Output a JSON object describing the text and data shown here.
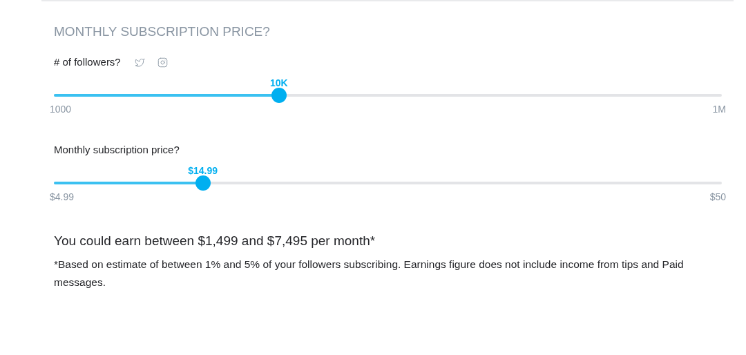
{
  "heading": "MONTHLY SUBSCRIPTION PRICE?",
  "sliders": [
    {
      "label": "# of followers?",
      "social_icons": true,
      "value": "10K",
      "level": 0.337,
      "min": "1000",
      "max": "1M"
    },
    {
      "label": "Monthly subscription price?",
      "social_icons": false,
      "value": "$14.99",
      "level": 0.223,
      "min": "$4.99",
      "max": "$50"
    }
  ],
  "earnings": "You could earn between $1,499 and $7,495 per month*",
  "footnote": "*Based on estimate of between 1% and 5% of your followers subscribing. Earnings figure does not include income from tips and Paid messages."
}
